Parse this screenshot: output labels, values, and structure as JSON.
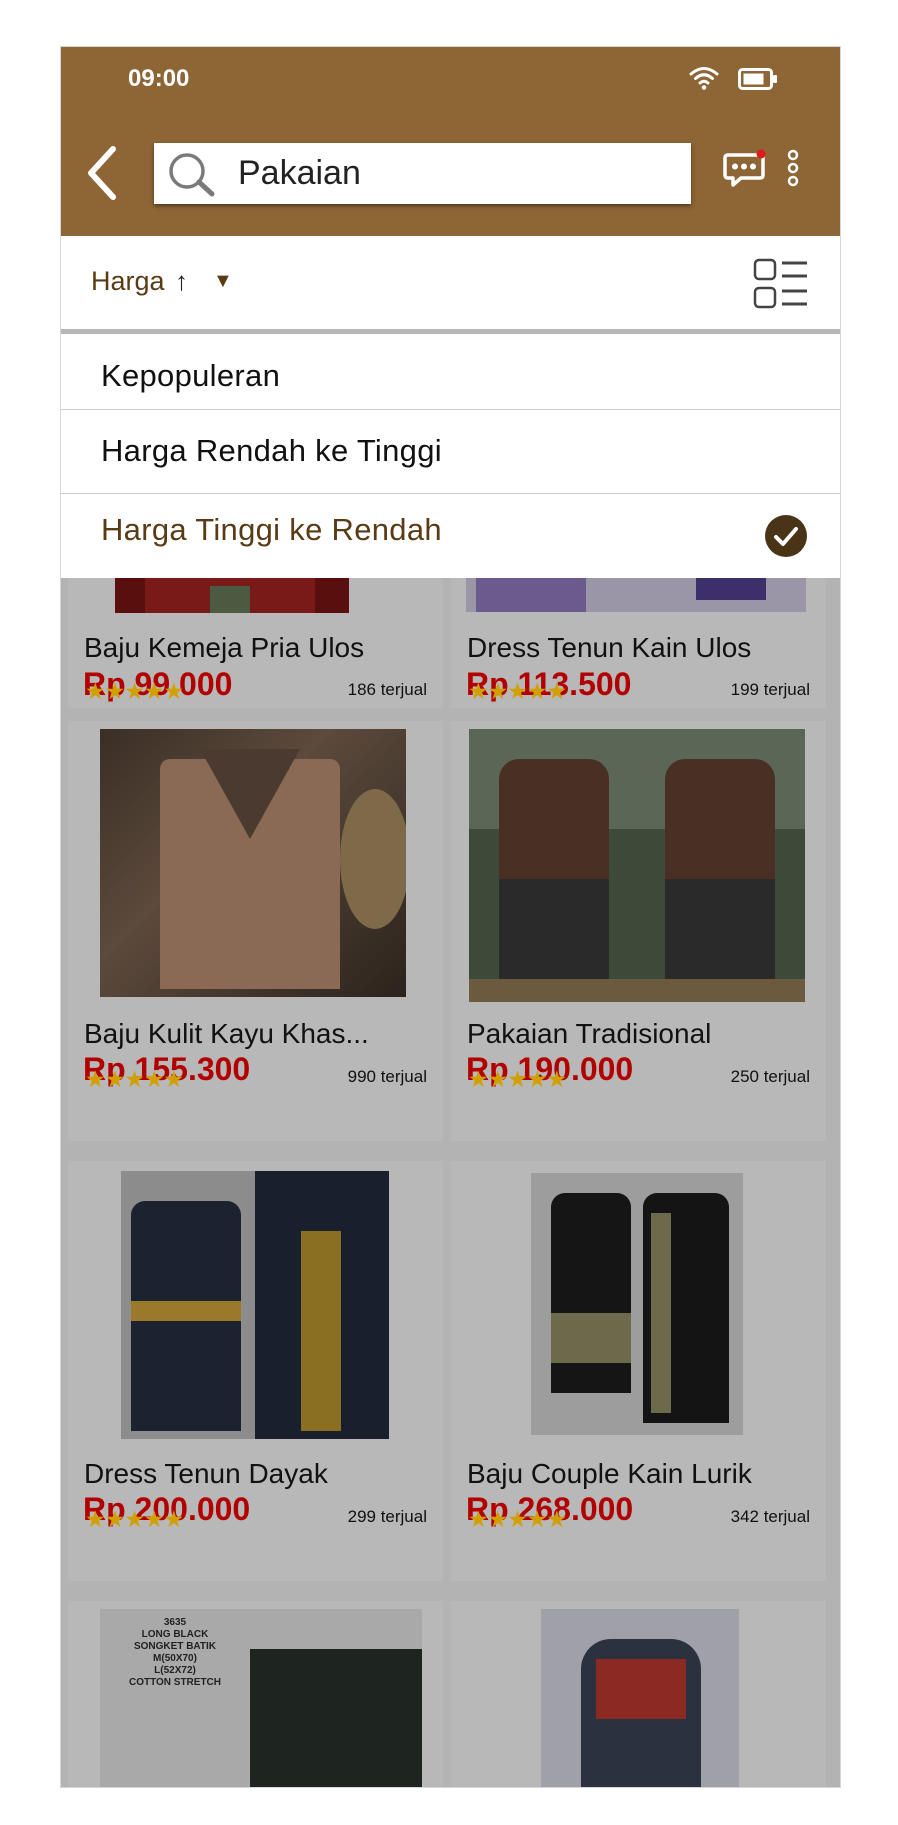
{
  "status_bar": {
    "time": "09:00"
  },
  "search": {
    "value": "Pakaian"
  },
  "sort": {
    "label": "Harga",
    "arrow": "↑",
    "caret": "▼",
    "options": [
      "Kepopuleran",
      "Harga Rendah ke Tinggi",
      "Harga Tinggi ke Rendah"
    ],
    "selected_index": 2
  },
  "colors": {
    "brand": "#8e6534",
    "accent_text": "#5b3b16",
    "price": "#b20000",
    "star": "#d1a000"
  },
  "products": [
    {
      "name": "Baju Kemeja Pria Ulos",
      "price": "Rp 99.000",
      "sold": "186 terjual",
      "rating": 5
    },
    {
      "name": "Dress Tenun Kain Ulos",
      "price": "Rp 113.500",
      "sold": "199 terjual",
      "rating": 5
    },
    {
      "name": "Baju Kulit Kayu Khas...",
      "price": "Rp 155.300",
      "sold": "990 terjual",
      "rating": 5
    },
    {
      "name": "Pakaian Tradisional",
      "price": "Rp 190.000",
      "sold": "250 terjual",
      "rating": 5
    },
    {
      "name": "Dress Tenun Dayak",
      "price": "Rp 200.000",
      "sold": "299 terjual",
      "rating": 5
    },
    {
      "name": "Baju Couple Kain Lurik",
      "price": "Rp 268.000",
      "sold": "342 terjual",
      "rating": 5
    },
    {
      "image_text": [
        "3635",
        "LONG BLACK",
        "SONGKET BATIK",
        "M(50X70)",
        "L(52X72)",
        "COTTON STRETCH"
      ]
    }
  ]
}
